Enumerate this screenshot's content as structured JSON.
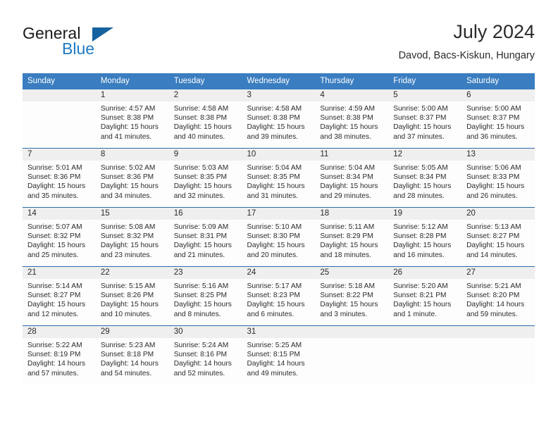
{
  "brand": {
    "name_part1": "General",
    "name_part2": "Blue",
    "accent_color": "#1f7ac4",
    "triangle_color": "#15629f"
  },
  "header": {
    "title": "July 2024",
    "subtitle": "Davod, Bacs-Kiskun, Hungary"
  },
  "theme": {
    "header_row_bg": "#3a7dc0",
    "daynum_band_bg": "#efefef",
    "row_separator": "#2d6ca8",
    "text": "#2b2b2b"
  },
  "calendar": {
    "weekday_headers": [
      "Sunday",
      "Monday",
      "Tuesday",
      "Wednesday",
      "Thursday",
      "Friday",
      "Saturday"
    ],
    "weeks": [
      [
        {
          "day": "",
          "lines": []
        },
        {
          "day": "1",
          "lines": [
            "Sunrise: 4:57 AM",
            "Sunset: 8:38 PM",
            "Daylight: 15 hours",
            "and 41 minutes."
          ]
        },
        {
          "day": "2",
          "lines": [
            "Sunrise: 4:58 AM",
            "Sunset: 8:38 PM",
            "Daylight: 15 hours",
            "and 40 minutes."
          ]
        },
        {
          "day": "3",
          "lines": [
            "Sunrise: 4:58 AM",
            "Sunset: 8:38 PM",
            "Daylight: 15 hours",
            "and 39 minutes."
          ]
        },
        {
          "day": "4",
          "lines": [
            "Sunrise: 4:59 AM",
            "Sunset: 8:38 PM",
            "Daylight: 15 hours",
            "and 38 minutes."
          ]
        },
        {
          "day": "5",
          "lines": [
            "Sunrise: 5:00 AM",
            "Sunset: 8:37 PM",
            "Daylight: 15 hours",
            "and 37 minutes."
          ]
        },
        {
          "day": "6",
          "lines": [
            "Sunrise: 5:00 AM",
            "Sunset: 8:37 PM",
            "Daylight: 15 hours",
            "and 36 minutes."
          ]
        }
      ],
      [
        {
          "day": "7",
          "lines": [
            "Sunrise: 5:01 AM",
            "Sunset: 8:36 PM",
            "Daylight: 15 hours",
            "and 35 minutes."
          ]
        },
        {
          "day": "8",
          "lines": [
            "Sunrise: 5:02 AM",
            "Sunset: 8:36 PM",
            "Daylight: 15 hours",
            "and 34 minutes."
          ]
        },
        {
          "day": "9",
          "lines": [
            "Sunrise: 5:03 AM",
            "Sunset: 8:35 PM",
            "Daylight: 15 hours",
            "and 32 minutes."
          ]
        },
        {
          "day": "10",
          "lines": [
            "Sunrise: 5:04 AM",
            "Sunset: 8:35 PM",
            "Daylight: 15 hours",
            "and 31 minutes."
          ]
        },
        {
          "day": "11",
          "lines": [
            "Sunrise: 5:04 AM",
            "Sunset: 8:34 PM",
            "Daylight: 15 hours",
            "and 29 minutes."
          ]
        },
        {
          "day": "12",
          "lines": [
            "Sunrise: 5:05 AM",
            "Sunset: 8:34 PM",
            "Daylight: 15 hours",
            "and 28 minutes."
          ]
        },
        {
          "day": "13",
          "lines": [
            "Sunrise: 5:06 AM",
            "Sunset: 8:33 PM",
            "Daylight: 15 hours",
            "and 26 minutes."
          ]
        }
      ],
      [
        {
          "day": "14",
          "lines": [
            "Sunrise: 5:07 AM",
            "Sunset: 8:32 PM",
            "Daylight: 15 hours",
            "and 25 minutes."
          ]
        },
        {
          "day": "15",
          "lines": [
            "Sunrise: 5:08 AM",
            "Sunset: 8:32 PM",
            "Daylight: 15 hours",
            "and 23 minutes."
          ]
        },
        {
          "day": "16",
          "lines": [
            "Sunrise: 5:09 AM",
            "Sunset: 8:31 PM",
            "Daylight: 15 hours",
            "and 21 minutes."
          ]
        },
        {
          "day": "17",
          "lines": [
            "Sunrise: 5:10 AM",
            "Sunset: 8:30 PM",
            "Daylight: 15 hours",
            "and 20 minutes."
          ]
        },
        {
          "day": "18",
          "lines": [
            "Sunrise: 5:11 AM",
            "Sunset: 8:29 PM",
            "Daylight: 15 hours",
            "and 18 minutes."
          ]
        },
        {
          "day": "19",
          "lines": [
            "Sunrise: 5:12 AM",
            "Sunset: 8:28 PM",
            "Daylight: 15 hours",
            "and 16 minutes."
          ]
        },
        {
          "day": "20",
          "lines": [
            "Sunrise: 5:13 AM",
            "Sunset: 8:27 PM",
            "Daylight: 15 hours",
            "and 14 minutes."
          ]
        }
      ],
      [
        {
          "day": "21",
          "lines": [
            "Sunrise: 5:14 AM",
            "Sunset: 8:27 PM",
            "Daylight: 15 hours",
            "and 12 minutes."
          ]
        },
        {
          "day": "22",
          "lines": [
            "Sunrise: 5:15 AM",
            "Sunset: 8:26 PM",
            "Daylight: 15 hours",
            "and 10 minutes."
          ]
        },
        {
          "day": "23",
          "lines": [
            "Sunrise: 5:16 AM",
            "Sunset: 8:25 PM",
            "Daylight: 15 hours",
            "and 8 minutes."
          ]
        },
        {
          "day": "24",
          "lines": [
            "Sunrise: 5:17 AM",
            "Sunset: 8:23 PM",
            "Daylight: 15 hours",
            "and 6 minutes."
          ]
        },
        {
          "day": "25",
          "lines": [
            "Sunrise: 5:18 AM",
            "Sunset: 8:22 PM",
            "Daylight: 15 hours",
            "and 3 minutes."
          ]
        },
        {
          "day": "26",
          "lines": [
            "Sunrise: 5:20 AM",
            "Sunset: 8:21 PM",
            "Daylight: 15 hours",
            "and 1 minute."
          ]
        },
        {
          "day": "27",
          "lines": [
            "Sunrise: 5:21 AM",
            "Sunset: 8:20 PM",
            "Daylight: 14 hours",
            "and 59 minutes."
          ]
        }
      ],
      [
        {
          "day": "28",
          "lines": [
            "Sunrise: 5:22 AM",
            "Sunset: 8:19 PM",
            "Daylight: 14 hours",
            "and 57 minutes."
          ]
        },
        {
          "day": "29",
          "lines": [
            "Sunrise: 5:23 AM",
            "Sunset: 8:18 PM",
            "Daylight: 14 hours",
            "and 54 minutes."
          ]
        },
        {
          "day": "30",
          "lines": [
            "Sunrise: 5:24 AM",
            "Sunset: 8:16 PM",
            "Daylight: 14 hours",
            "and 52 minutes."
          ]
        },
        {
          "day": "31",
          "lines": [
            "Sunrise: 5:25 AM",
            "Sunset: 8:15 PM",
            "Daylight: 14 hours",
            "and 49 minutes."
          ]
        },
        {
          "day": "",
          "lines": []
        },
        {
          "day": "",
          "lines": []
        },
        {
          "day": "",
          "lines": []
        }
      ]
    ]
  }
}
